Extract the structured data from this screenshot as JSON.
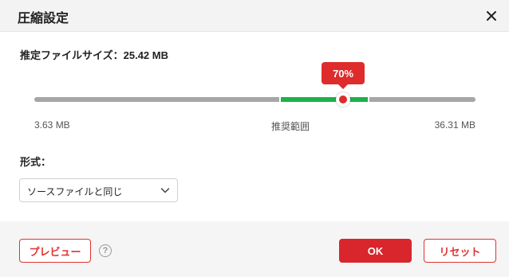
{
  "dialog": {
    "title": "圧縮設定",
    "close_icon": "close-icon"
  },
  "estimate": {
    "label": "推定ファイルサイズ：",
    "value": "25.42 MB"
  },
  "slider": {
    "percent": 70,
    "percent_label": "70%",
    "recommended_from_percent": 55.5,
    "recommended_to_percent": 76.0,
    "min_label": "3.63 MB",
    "mid_label": "推奨範囲",
    "max_label": "36.31 MB",
    "track_color": "#a6a6a6",
    "range_color": "#1ab24b",
    "accent_color": "#de2b2b"
  },
  "format": {
    "label": "形式：",
    "selected": "ソースファイルと同じ",
    "arrow_icon": "chevron-down-icon"
  },
  "footer": {
    "preview_label": "プレビュー",
    "help_icon": "help-icon",
    "help_glyph": "?",
    "ok_label": "OK",
    "reset_label": "リセット"
  }
}
